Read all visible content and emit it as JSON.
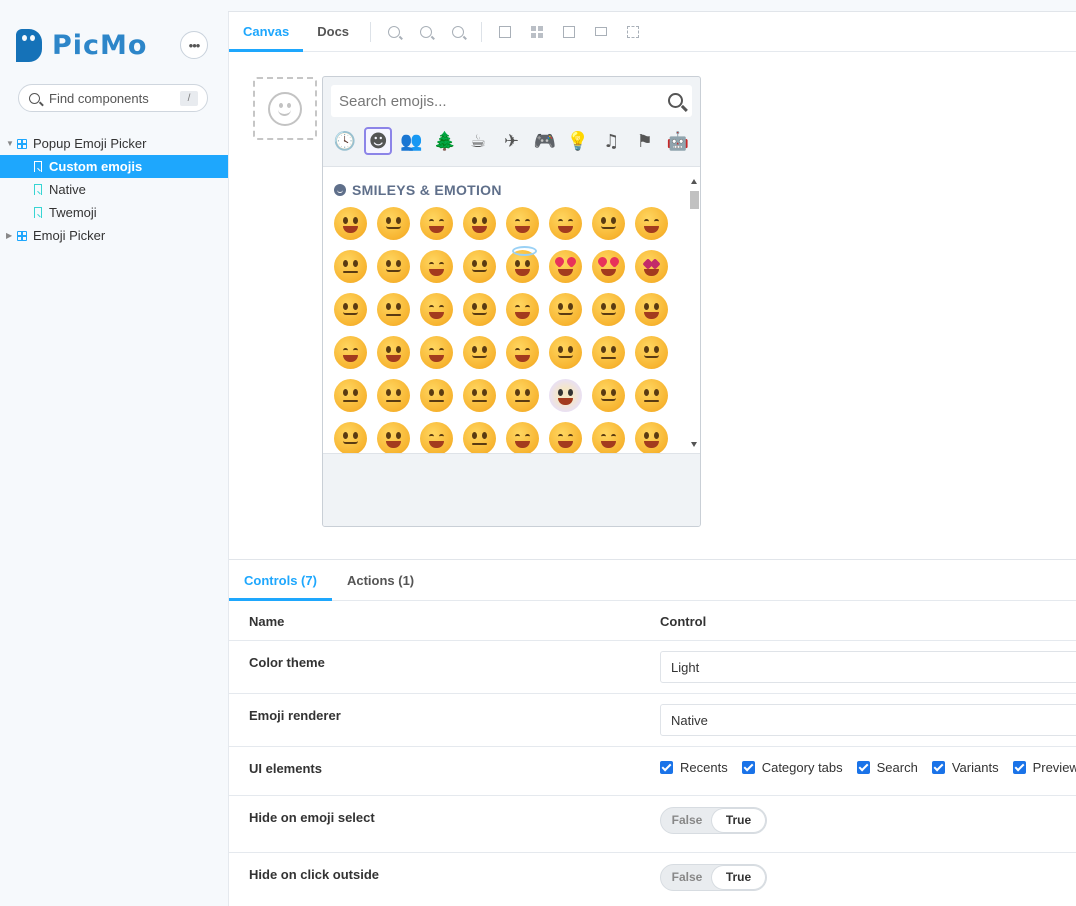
{
  "sidebar": {
    "brand": "PicMo",
    "more_label": "•••",
    "search": {
      "placeholder": "Find components",
      "shortcut": "/"
    },
    "tree": [
      {
        "label": "Popup Emoji Picker",
        "type": "component",
        "expanded": true
      },
      {
        "label": "Custom emojis",
        "type": "story",
        "selected": true
      },
      {
        "label": "Native",
        "type": "story"
      },
      {
        "label": "Twemoji",
        "type": "story"
      },
      {
        "label": "Emoji Picker",
        "type": "component",
        "expanded": false
      }
    ]
  },
  "toolbar": {
    "tabs": [
      "Canvas",
      "Docs"
    ],
    "active_tab": "Canvas",
    "tools": [
      "zoom-in-icon",
      "zoom-out-icon",
      "reset-zoom-icon",
      "background-icon",
      "grid-icon",
      "viewport-icon",
      "measure-icon",
      "outline-icon"
    ]
  },
  "picker": {
    "search_placeholder": "Search emojis...",
    "categories": [
      {
        "name": "recents",
        "glyph": "🕓"
      },
      {
        "name": "smileys-emotion",
        "glyph": "☻",
        "active": true
      },
      {
        "name": "people-body",
        "glyph": "👥"
      },
      {
        "name": "animals-nature",
        "glyph": "🌲"
      },
      {
        "name": "food-drink",
        "glyph": "☕"
      },
      {
        "name": "travel-places",
        "glyph": "✈"
      },
      {
        "name": "activities",
        "glyph": "🎮"
      },
      {
        "name": "objects",
        "glyph": "💡"
      },
      {
        "name": "symbols",
        "glyph": "♫"
      },
      {
        "name": "flags",
        "glyph": "⚑"
      },
      {
        "name": "custom",
        "glyph": "🤖"
      }
    ],
    "category_title": "SMILEYS & EMOTION",
    "emoji_rows": 6,
    "emoji_cols": 8
  },
  "panel": {
    "tabs": [
      {
        "label": "Controls (7)",
        "active": true
      },
      {
        "label": "Actions (1)"
      }
    ],
    "columns": {
      "name": "Name",
      "control": "Control"
    },
    "rows": {
      "color_theme": {
        "name": "Color theme",
        "value": "Light"
      },
      "emoji_renderer": {
        "name": "Emoji renderer",
        "value": "Native"
      },
      "ui_elements": {
        "name": "UI elements",
        "options": [
          "Recents",
          "Category tabs",
          "Search",
          "Variants",
          "Preview"
        ]
      },
      "hide_on_select": {
        "name": "Hide on emoji select",
        "false_label": "False",
        "true_label": "True",
        "value": true
      },
      "hide_on_click": {
        "name": "Hide on click outside",
        "false_label": "False",
        "true_label": "True",
        "value": true
      }
    }
  },
  "colors": {
    "accent": "#1ea7fd",
    "brand": "#2d86c9",
    "emoji": "#f7b430"
  }
}
